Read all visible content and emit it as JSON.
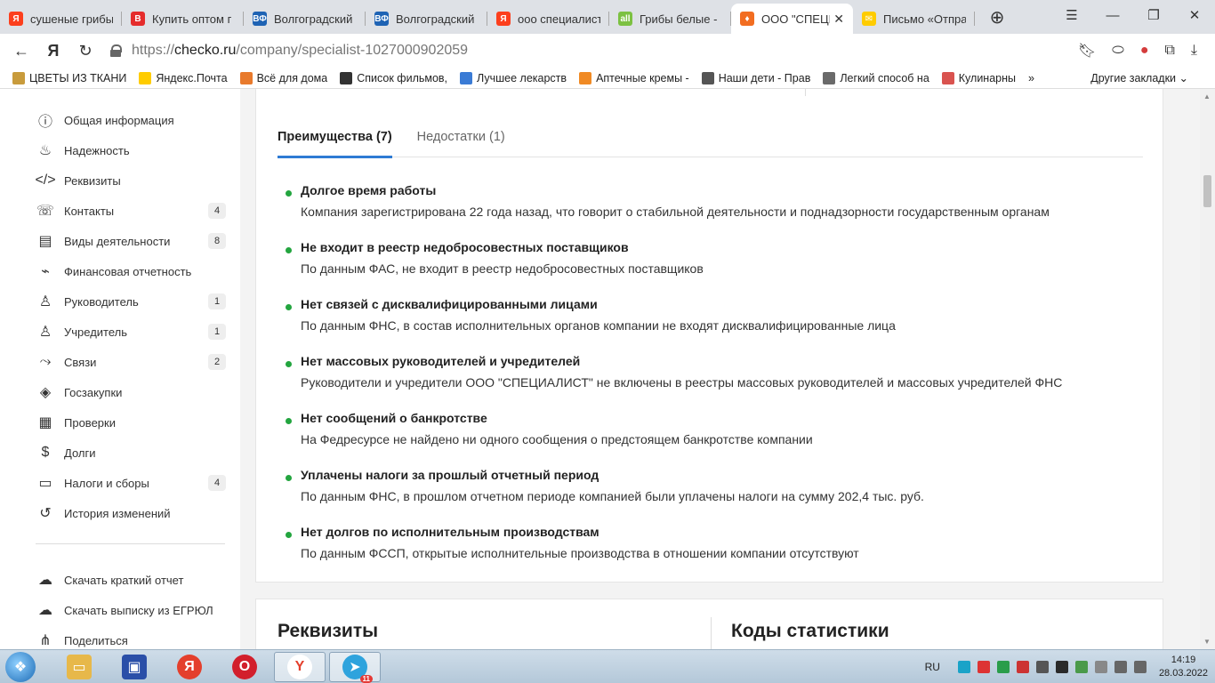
{
  "tabs": [
    {
      "label": "сушеные грибы",
      "icon_color": "#fc3f1d",
      "icon_letter": "Я",
      "active": false
    },
    {
      "label": "Купить оптом г",
      "icon_color": "#e52c2c",
      "icon_letter": "B",
      "active": false
    },
    {
      "label": "Волгоградский",
      "icon_color": "#1e63b4",
      "icon_letter": "ВФ",
      "active": false
    },
    {
      "label": "Волгоградский",
      "icon_color": "#1e63b4",
      "icon_letter": "ВФ",
      "active": false
    },
    {
      "label": "ооо специалист",
      "icon_color": "#fc3f1d",
      "icon_letter": "Я",
      "active": false
    },
    {
      "label": "Грибы белые -",
      "icon_color": "#7cc142",
      "icon_letter": "all",
      "active": false
    },
    {
      "label": "ООО \"СПЕЦИ",
      "icon_color": "#f26d21",
      "icon_letter": "♦",
      "active": true
    },
    {
      "label": "Письмо «Отпра",
      "icon_color": "#ffcc00",
      "icon_letter": "✉",
      "active": false
    }
  ],
  "address": {
    "scheme": "https://",
    "host": "checko.ru",
    "path": "/company/specialist-1027000902059"
  },
  "bookmarks": [
    {
      "label": "ЦВЕТЫ ИЗ ТКАНИ",
      "color": "#c89b3c"
    },
    {
      "label": "Яндекс.Почта",
      "color": "#ffcc00"
    },
    {
      "label": "Всё для дома",
      "color": "#e87a2c"
    },
    {
      "label": "Список фильмов,",
      "color": "#333333"
    },
    {
      "label": "Лучшее лекарств",
      "color": "#3a7bd5"
    },
    {
      "label": "Аптечные кремы -",
      "color": "#f08a24"
    },
    {
      "label": "Наши дети - Прав",
      "color": "#555555"
    },
    {
      "label": "Легкий способ на",
      "color": "#6a6a6a"
    },
    {
      "label": "Кулинарны",
      "color": "#d9534f"
    }
  ],
  "bookmarks_more": "Другие закладки",
  "sidebar": {
    "items": [
      {
        "label": "Общая информация",
        "icon": "info-icon",
        "glyph": "ⓘ",
        "count": ""
      },
      {
        "label": "Надежность",
        "icon": "flame-icon",
        "glyph": "♨",
        "count": ""
      },
      {
        "label": "Реквизиты",
        "icon": "code-icon",
        "glyph": "</>",
        "count": ""
      },
      {
        "label": "Контакты",
        "icon": "phone-icon",
        "glyph": "☏",
        "count": "4"
      },
      {
        "label": "Виды деятельности",
        "icon": "briefcase-icon",
        "glyph": "▤",
        "count": "8"
      },
      {
        "label": "Финансовая отчетность",
        "icon": "chart-icon",
        "glyph": "⌁",
        "count": ""
      },
      {
        "label": "Руководитель",
        "icon": "person-icon",
        "glyph": "♙",
        "count": "1"
      },
      {
        "label": "Учредитель",
        "icon": "people-icon",
        "glyph": "♙",
        "count": "1"
      },
      {
        "label": "Связи",
        "icon": "links-icon",
        "glyph": "⤳",
        "count": "2"
      },
      {
        "label": "Госзакупки",
        "icon": "layers-icon",
        "glyph": "◈",
        "count": ""
      },
      {
        "label": "Проверки",
        "icon": "calendar-icon",
        "glyph": "▦",
        "count": ""
      },
      {
        "label": "Долги",
        "icon": "money-icon",
        "glyph": "$",
        "count": ""
      },
      {
        "label": "Налоги и сборы",
        "icon": "wallet-icon",
        "glyph": "▭",
        "count": "4"
      },
      {
        "label": "История изменений",
        "icon": "history-icon",
        "glyph": "↺",
        "count": ""
      }
    ],
    "actions": [
      {
        "label": "Скачать краткий отчет",
        "icon": "cloud-download-icon",
        "glyph": "☁"
      },
      {
        "label": "Скачать выписку из ЕГРЮЛ",
        "icon": "cloud-download-icon",
        "glyph": "☁"
      },
      {
        "label": "Поделиться",
        "icon": "share-icon",
        "glyph": "⋔"
      }
    ]
  },
  "content_tabs": [
    {
      "label": "Преимущества (7)",
      "active": true
    },
    {
      "label": "Недостатки (1)",
      "active": false
    }
  ],
  "advantages": [
    {
      "title": "Долгое время работы",
      "desc": "Компания зарегистрирована 22 года назад, что говорит о стабильной деятельности и поднадзорности государственным органам"
    },
    {
      "title": "Не входит в реестр недобросовестных поставщиков",
      "desc": "По данным ФАС, не входит в реестр недобросовестных поставщиков"
    },
    {
      "title": "Нет связей с дисквалифицированными лицами",
      "desc": "По данным ФНС, в состав исполнительных органов компании не входят дисквалифицированные лица"
    },
    {
      "title": "Нет массовых руководителей и учредителей",
      "desc": "Руководители и учредители ООО \"СПЕЦИАЛИСТ\" не включены в реестры массовых руководителей и массовых учредителей ФНС"
    },
    {
      "title": "Нет сообщений о банкротстве",
      "desc": "На Федресурсе не найдено ни одного сообщения о предстоящем банкротстве компании"
    },
    {
      "title": "Уплачены налоги за прошлый отчетный период",
      "desc": "По данным ФНС, в прошлом отчетном периоде компанией были уплачены налоги на сумму 202,4 тыс. руб."
    },
    {
      "title": "Нет долгов по исполнительным производствам",
      "desc": "По данным ФССП, открытые исполнительные производства в отношении компании отсутствуют"
    }
  ],
  "sections": {
    "requisites": "Реквизиты",
    "stat_codes": "Коды статистики"
  },
  "colors": {
    "accent": "#2e7bd4",
    "positive": "#23a53f"
  },
  "taskbar": {
    "lang": "RU",
    "time": "14:19",
    "date": "28.03.2022",
    "telegram_badge": "11"
  }
}
